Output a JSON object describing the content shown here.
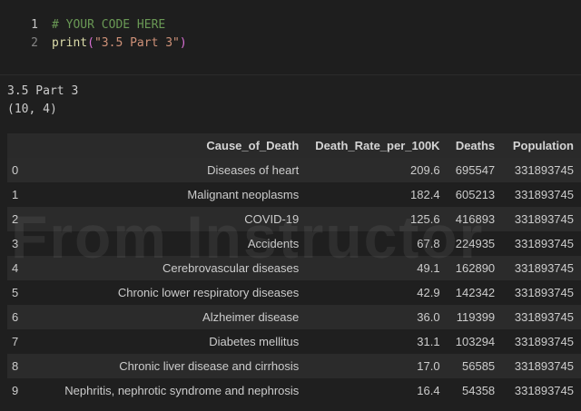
{
  "editor": {
    "lines": [
      {
        "number": "1",
        "tokens": [
          {
            "type": "comment",
            "text": "# YOUR CODE HERE"
          }
        ]
      },
      {
        "number": "2",
        "tokens": [
          {
            "type": "fn",
            "text": "print"
          },
          {
            "type": "paren",
            "text": "("
          },
          {
            "type": "str",
            "text": "\"3.5 Part 3\""
          },
          {
            "type": "paren",
            "text": ")"
          }
        ]
      }
    ]
  },
  "output": {
    "lines": [
      "3.5 Part 3",
      "(10, 4)"
    ]
  },
  "watermark": "From Instructor",
  "table": {
    "columns": [
      "",
      "Cause_of_Death",
      "Death_Rate_per_100K",
      "Deaths",
      "Population"
    ],
    "rows": [
      [
        "0",
        "Diseases of heart",
        "209.6",
        "695547",
        "331893745"
      ],
      [
        "1",
        "Malignant neoplasms",
        "182.4",
        "605213",
        "331893745"
      ],
      [
        "2",
        "COVID-19",
        "125.6",
        "416893",
        "331893745"
      ],
      [
        "3",
        "Accidents",
        "67.8",
        "224935",
        "331893745"
      ],
      [
        "4",
        "Cerebrovascular diseases",
        "49.1",
        "162890",
        "331893745"
      ],
      [
        "5",
        "Chronic lower respiratory diseases",
        "42.9",
        "142342",
        "331893745"
      ],
      [
        "6",
        "Alzheimer disease",
        "36.0",
        "119399",
        "331893745"
      ],
      [
        "7",
        "Diabetes mellitus",
        "31.1",
        "103294",
        "331893745"
      ],
      [
        "8",
        "Chronic liver disease and cirrhosis",
        "17.0",
        "56585",
        "331893745"
      ],
      [
        "9",
        "Nephritis, nephrotic syndrome and nephrosis",
        "16.4",
        "54358",
        "331893745"
      ]
    ]
  }
}
